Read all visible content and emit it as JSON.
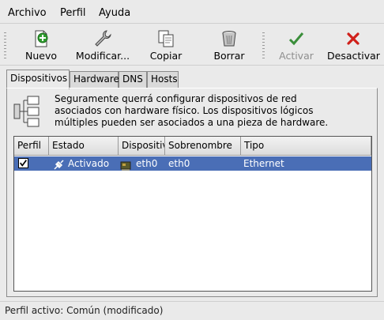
{
  "menubar": {
    "items": [
      {
        "label": "Archivo"
      },
      {
        "label": "Perfil"
      },
      {
        "label": "Ayuda"
      }
    ]
  },
  "toolbar": {
    "buttons": [
      {
        "label": "Nuevo",
        "icon": "new-icon",
        "enabled": true
      },
      {
        "label": "Modificar...",
        "icon": "wrench-icon",
        "enabled": true
      },
      {
        "label": "Copiar",
        "icon": "copy-icon",
        "enabled": true
      },
      {
        "label": "Borrar",
        "icon": "trash-icon",
        "enabled": true
      },
      {
        "label": "Activar",
        "icon": "checkmark-icon",
        "enabled": false
      },
      {
        "label": "Desactivar",
        "icon": "x-icon",
        "enabled": true
      }
    ]
  },
  "tabs": [
    {
      "label": "Dispositivos",
      "active": true
    },
    {
      "label": "Hardware",
      "active": false
    },
    {
      "label": "DNS",
      "active": false
    },
    {
      "label": "Hosts",
      "active": false
    }
  ],
  "panel": {
    "info_lines": [
      "Seguramente querrá configurar dispositivos de red",
      "asociados con hardware físico. Los dispositivos lógicos",
      "múltiples pueden ser asociados a una pieza de hardware."
    ]
  },
  "table": {
    "columns": [
      "Perfil",
      "Estado",
      "Dispositivo",
      "Sobrenombre",
      "Tipo"
    ],
    "rows": [
      {
        "perfil_checked": true,
        "estado": "Activado",
        "dispositivo": "eth0",
        "sobrenombre": "eth0",
        "tipo": "Ethernet",
        "selected": true
      }
    ]
  },
  "statusbar": {
    "text": "Perfil activo: Común (modificado)"
  },
  "colors": {
    "selection": "#4a6eb6",
    "new_icon": "#2e9b2e",
    "activate_icon": "#3a8e3a",
    "deactivate_icon": "#d0201a"
  }
}
